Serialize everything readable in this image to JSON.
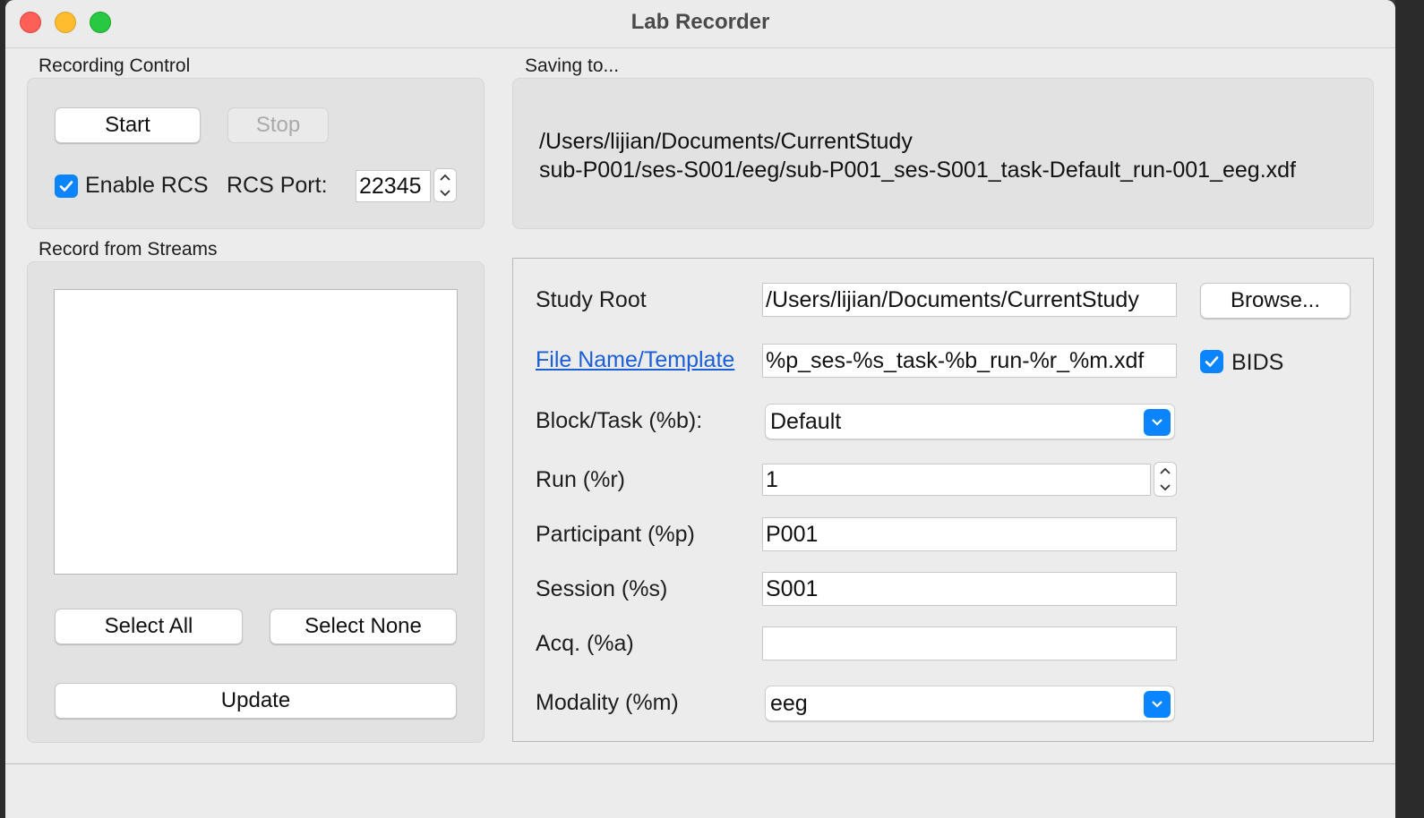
{
  "window": {
    "title": "Lab Recorder"
  },
  "recording_control": {
    "group_label": "Recording Control",
    "start_label": "Start",
    "stop_label": "Stop",
    "enable_rcs_label": "Enable RCS",
    "enable_rcs_checked": true,
    "rcs_port_label": "RCS Port:",
    "rcs_port_value": "22345"
  },
  "saving": {
    "group_label": "Saving to...",
    "path_line1": "/Users/lijian/Documents/CurrentStudy",
    "path_line2": "sub-P001/ses-S001/eeg/sub-P001_ses-S001_task-Default_run-001_eeg.xdf"
  },
  "streams": {
    "group_label": "Record from Streams",
    "items": [],
    "select_all_label": "Select All",
    "select_none_label": "Select None",
    "update_label": "Update"
  },
  "form": {
    "study_root_label": "Study Root",
    "study_root_value": "/Users/lijian/Documents/CurrentStudy",
    "browse_label": "Browse...",
    "filename_label": "File Name/Template",
    "filename_value": "%p_ses-%s_task-%b_run-%r_%m.xdf",
    "bids_label": "BIDS",
    "bids_checked": true,
    "block_label": "Block/Task (%b):",
    "block_value": "Default",
    "run_label": "Run (%r)",
    "run_value": "1",
    "participant_label": "Participant (%p)",
    "participant_value": "P001",
    "session_label": "Session (%s)",
    "session_value": "S001",
    "acq_label": "Acq. (%a)",
    "acq_value": "",
    "modality_label": "Modality (%m)",
    "modality_value": "eeg"
  },
  "colors": {
    "accent": "#0a84ff",
    "link": "#1a5fd6",
    "window_bg": "#ececec"
  }
}
